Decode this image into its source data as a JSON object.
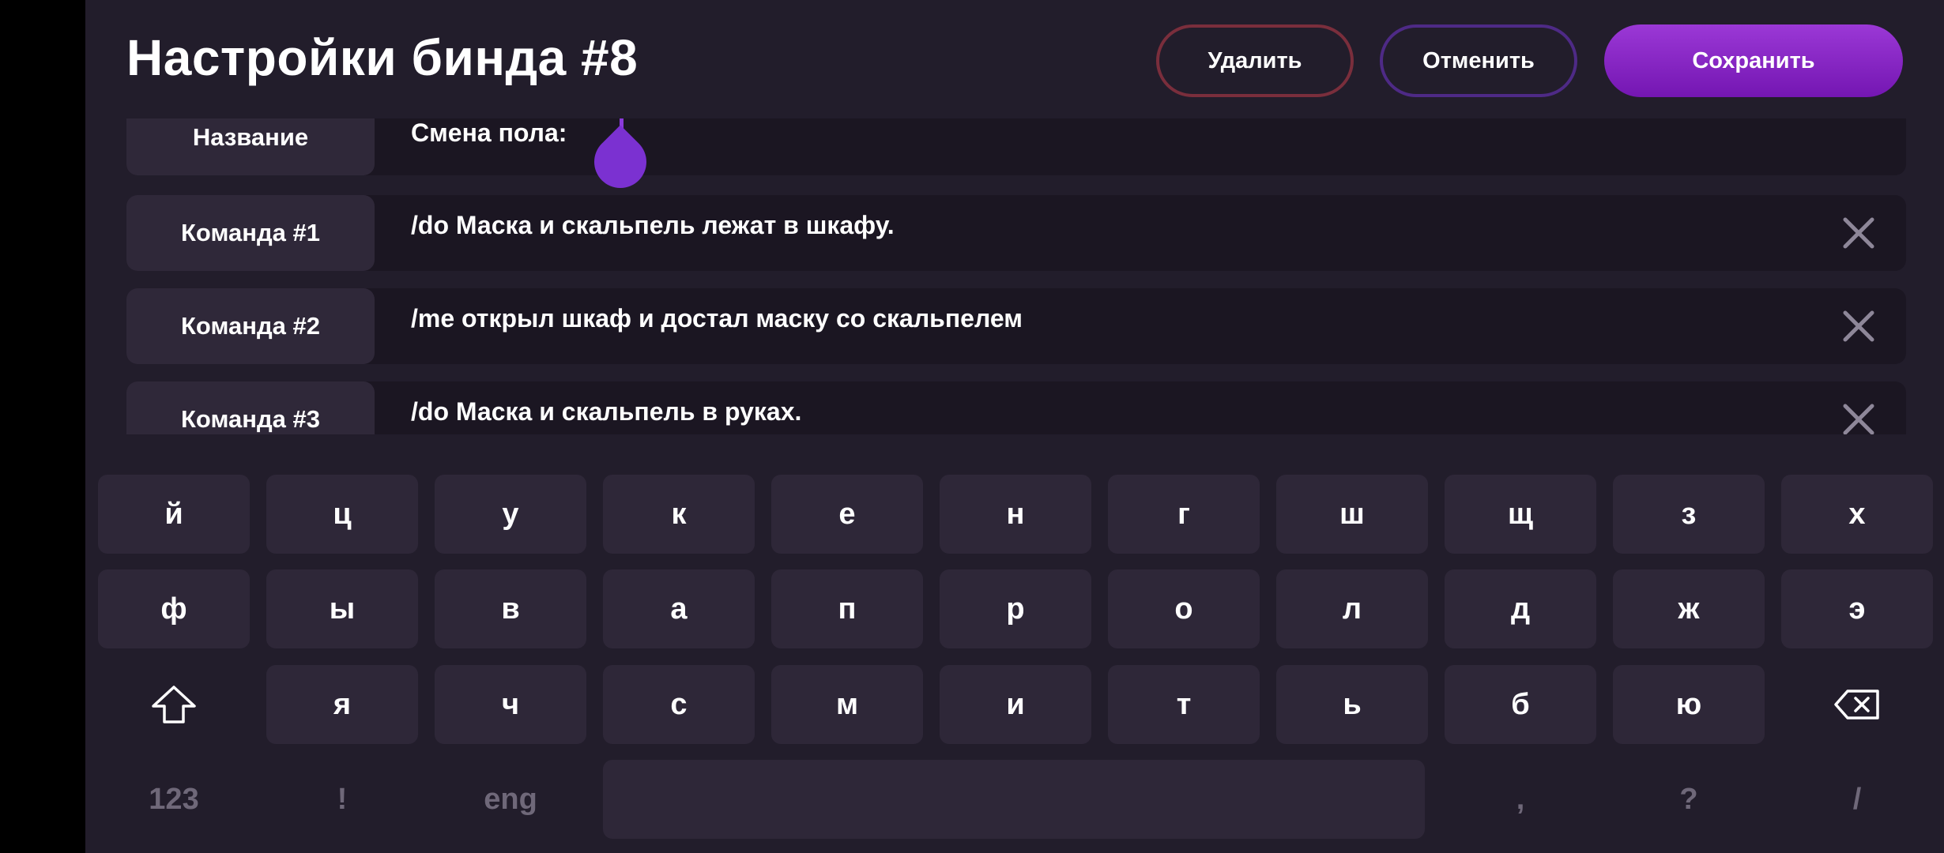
{
  "header": {
    "title": "Настройки бинда #8",
    "delete_label": "Удалить",
    "cancel_label": "Отменить",
    "save_label": "Сохранить"
  },
  "fields": [
    {
      "label": "Название",
      "value": "Смена пола:"
    },
    {
      "label": "Команда #1",
      "value": "/do Маска и скальпель лежат в шкафу."
    },
    {
      "label": "Команда #2",
      "value": "/me открыл шкаф и достал маску со скальпелем"
    },
    {
      "label": "Команда #3",
      "value": "/do Маска и скальпель в руках."
    }
  ],
  "keyboard": {
    "row1": [
      "й",
      "ц",
      "у",
      "к",
      "е",
      "н",
      "г",
      "ш",
      "щ",
      "з",
      "х"
    ],
    "row2": [
      "ф",
      "ы",
      "в",
      "а",
      "п",
      "р",
      "о",
      "л",
      "д",
      "ж",
      "э"
    ],
    "row3": [
      "я",
      "ч",
      "с",
      "м",
      "и",
      "т",
      "ь",
      "б",
      "ю"
    ],
    "row4": {
      "numbers": "123",
      "exclaim": "!",
      "lang": "eng",
      "comma": ",",
      "question": "?",
      "slash": "/"
    }
  },
  "colors": {
    "background": "#221d2b",
    "accent": "#7b31d1",
    "delete_border": "#7a2e3c"
  }
}
